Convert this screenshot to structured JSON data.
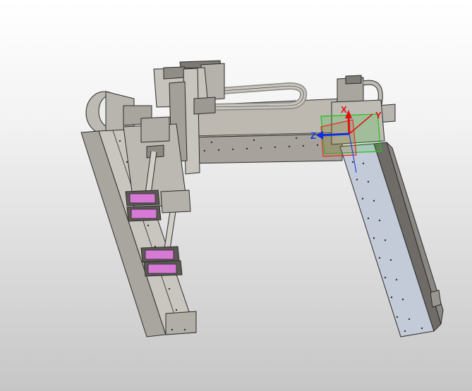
{
  "viewport": {
    "background_top": "#ffffff",
    "background_bottom": "#c6c6c6"
  },
  "model": {
    "metal_light": "#c9c6bf",
    "metal_mid": "#a9a6a0",
    "metal_dark": "#7d7a75",
    "rail_face": "#c3cad8",
    "edge": "#2b2b2b",
    "pads_color": "#d67ad6"
  },
  "triad": {
    "x_label": "X",
    "y_label": "Y",
    "z_label": "Z",
    "x_color": "#e01010",
    "y_color": "#e01010",
    "z_color": "#1030e0",
    "plane_green": "#22c022",
    "plane_red": "#e03030"
  }
}
